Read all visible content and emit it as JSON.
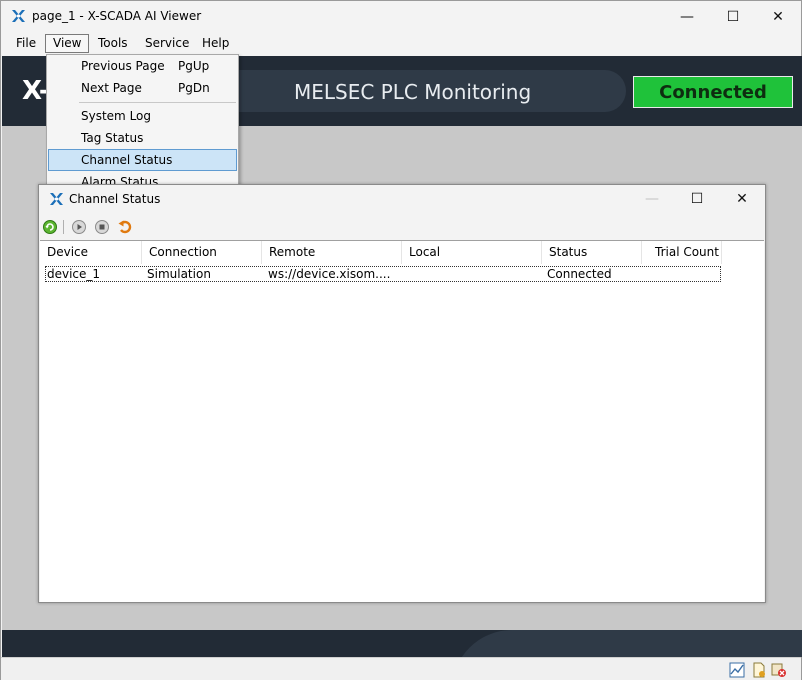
{
  "window": {
    "title": "page_1 - X-SCADA AI Viewer",
    "controls": {
      "minimize": "—",
      "maximize": "☐",
      "close": "✕"
    }
  },
  "menubar": {
    "items": [
      {
        "label": "File"
      },
      {
        "label": "View"
      },
      {
        "label": "Tools"
      },
      {
        "label": "Service"
      },
      {
        "label": "Help"
      }
    ]
  },
  "banner": {
    "logo": "X-",
    "title": "MELSEC PLC Monitoring",
    "status": "Connected"
  },
  "view_menu": {
    "items": [
      {
        "label": "Previous Page",
        "shortcut": "PgUp"
      },
      {
        "label": "Next Page",
        "shortcut": "PgDn"
      },
      {
        "label": "System Log",
        "shortcut": ""
      },
      {
        "label": "Tag Status",
        "shortcut": ""
      },
      {
        "label": "Channel Status",
        "shortcut": ""
      },
      {
        "label": "Alarm Status",
        "shortcut": ""
      }
    ]
  },
  "channel_status": {
    "title": "Channel Status",
    "controls": {
      "minimize": "—",
      "maximize": "☐",
      "close": "✕"
    },
    "toolbar": [
      "refresh-icon",
      "play-icon",
      "stop-icon",
      "undo-icon"
    ],
    "columns": [
      "Device",
      "Connection",
      "Remote",
      "Local",
      "Status",
      "Trial Count"
    ],
    "rows": [
      {
        "device": "device_1",
        "connection": "Simulation",
        "remote": "ws://device.xisom....",
        "local": "",
        "status": "Connected",
        "trial_count": ""
      }
    ]
  },
  "colors": {
    "banner_bg": "#222b36",
    "connected_green": "#1fc23a",
    "menu_highlight": "#cce4f7"
  }
}
